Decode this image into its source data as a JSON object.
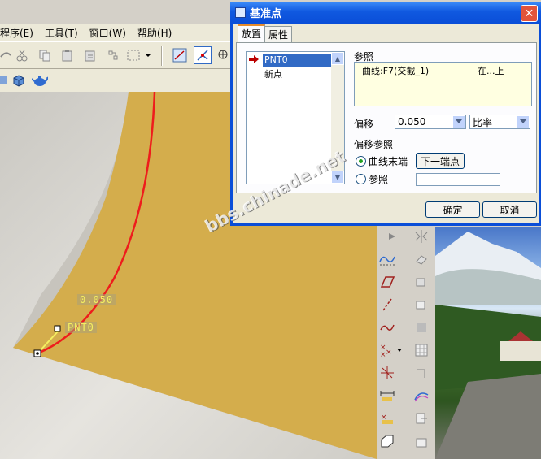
{
  "menubar": {
    "items": [
      "程序(E)",
      "工具(T)",
      "窗口(W)",
      "帮助(H)"
    ]
  },
  "dialog": {
    "title": "基准点",
    "close": "✕",
    "tabs": [
      "放置",
      "属性"
    ],
    "points_list": [
      "PNT0",
      "新点"
    ],
    "reference_label": "参照",
    "reference_value": "曲线:F7(交截_1)",
    "reference_position": "在...上",
    "offset_label": "偏移",
    "offset_value": "0.050",
    "offset_type": "比率",
    "offset_ref_label": "偏移参照",
    "radio_curve_end": "曲线末端",
    "next_endpoint_button": "下一端点",
    "radio_reference": "参照",
    "ok_button": "确定",
    "cancel_button": "取消"
  },
  "viewport": {
    "offset_annotation": "0.050",
    "point_label": "PNT0"
  },
  "watermark": "bbs.chinade.net",
  "colors": {
    "surface": "#d4ad4c",
    "curve": "#ee1c1c",
    "titlebar": "#0a4ed8",
    "selection": "#316ac5"
  }
}
